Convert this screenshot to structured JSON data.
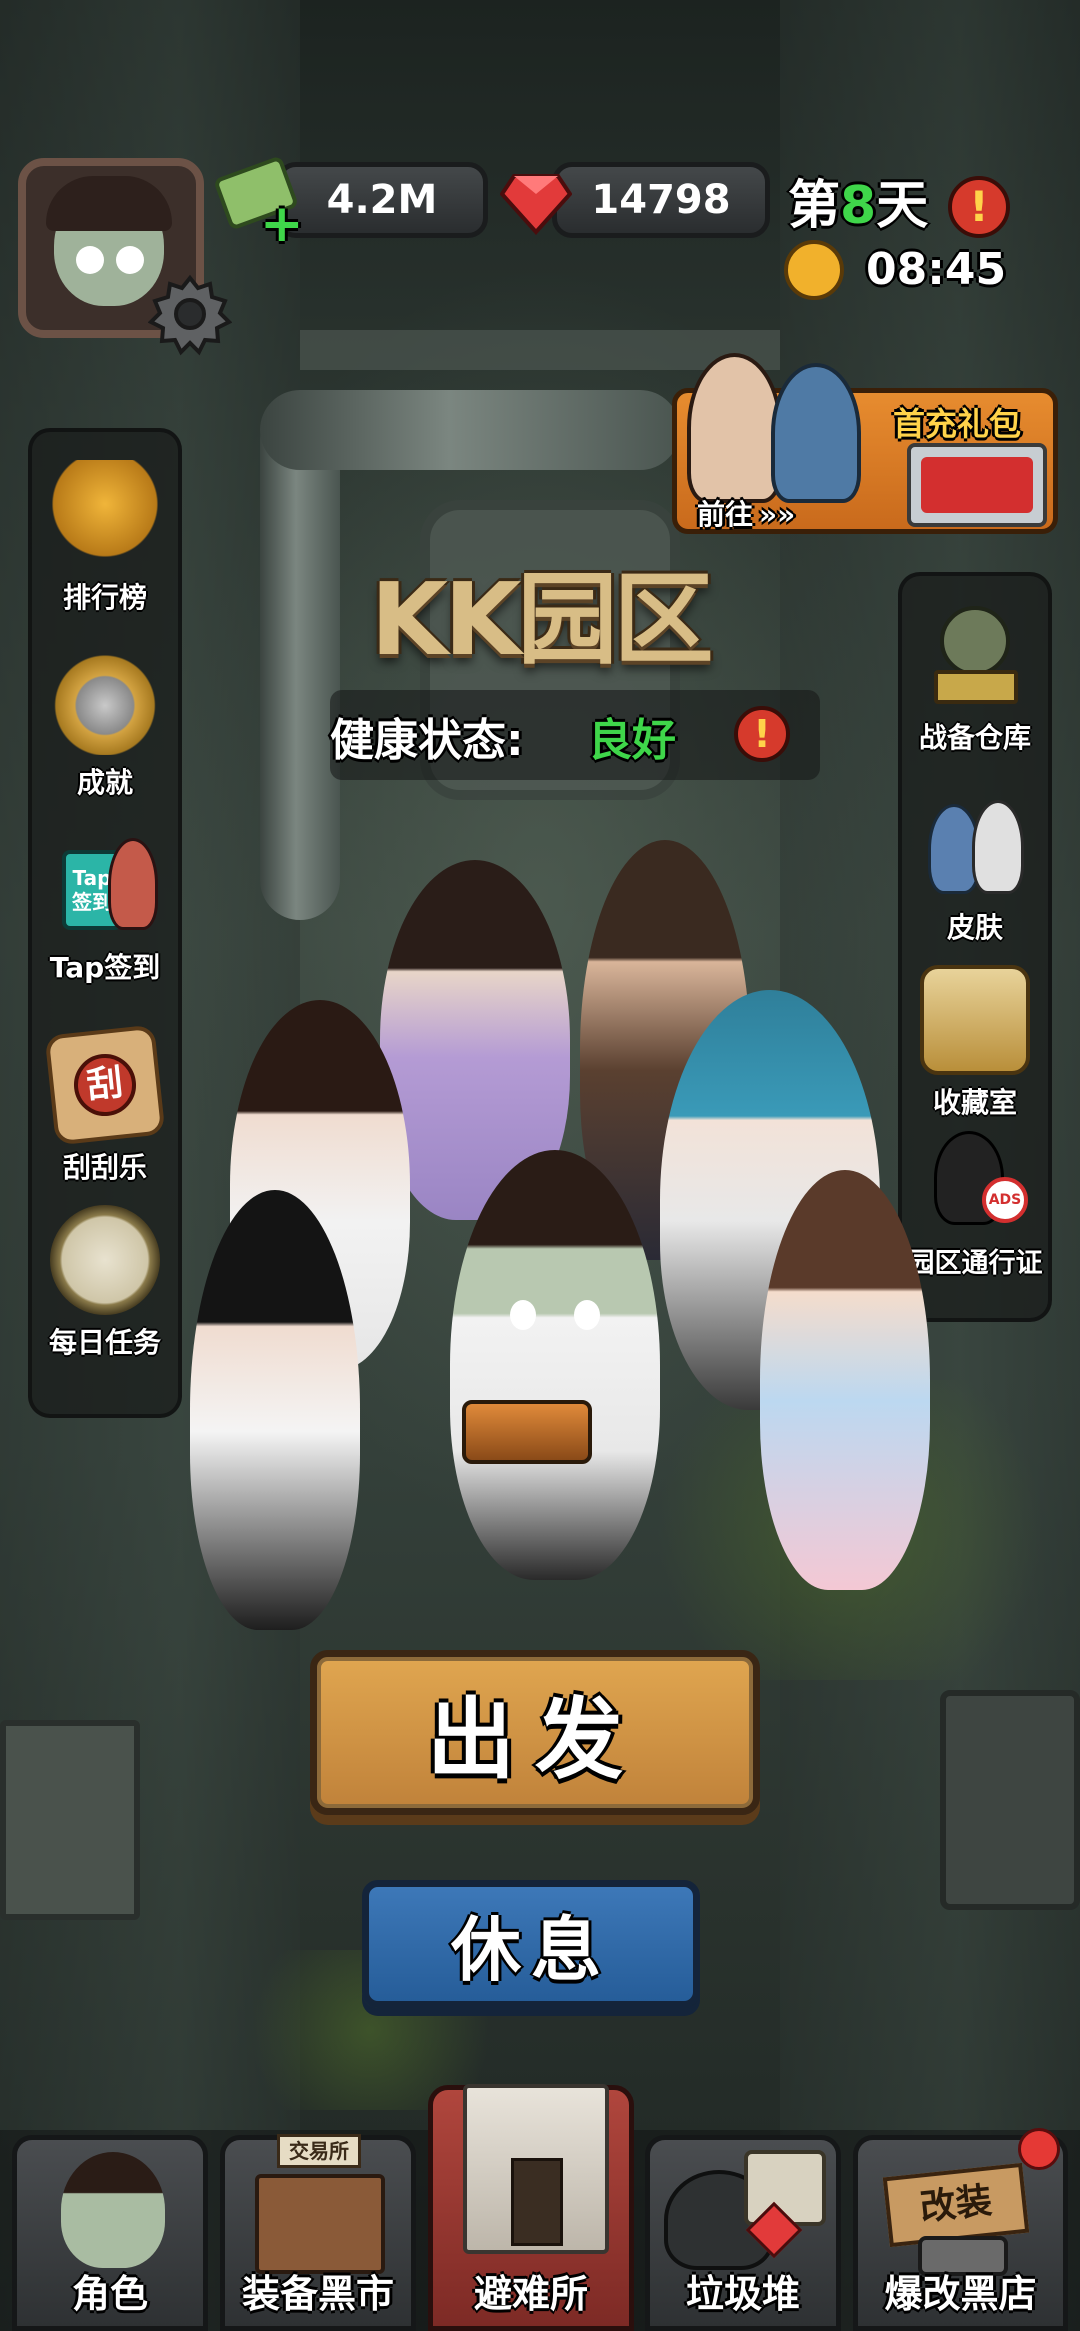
{
  "hud": {
    "cash": "4.2M",
    "gems": "14798",
    "day_prefix": "第",
    "day_number": "8",
    "day_suffix": "天",
    "time": "08:45",
    "alert_icon": "exclamation-icon"
  },
  "promo": {
    "title": "首充礼包",
    "go_label": "前往",
    "arrows": "»»"
  },
  "location": {
    "title": "KK园区",
    "health_label": "健康状态:",
    "health_value": "良好"
  },
  "left_menu": [
    {
      "label": "排行榜",
      "icon": "trophy-icon"
    },
    {
      "label": "成就",
      "icon": "medal-icon"
    },
    {
      "label": "Tap签到",
      "icon": "tap-signin-icon",
      "badge": "Tap",
      "badge_sub": "签到"
    },
    {
      "label": "刮刮乐",
      "icon": "scratch-card-icon",
      "badge": "刮"
    },
    {
      "label": "每日任务",
      "icon": "compass-icon"
    }
  ],
  "right_menu": [
    {
      "label": "战备仓库",
      "icon": "armory-icon"
    },
    {
      "label": "皮肤",
      "icon": "skin-icon"
    },
    {
      "label": "收藏室",
      "icon": "collection-icon"
    },
    {
      "label": "园区通行证",
      "icon": "pass-icon",
      "badge": "ADS"
    }
  ],
  "actions": {
    "go": "出发",
    "rest": "休息"
  },
  "bottom_nav": [
    {
      "label": "角色",
      "icon": "character-icon"
    },
    {
      "label": "装备黑市",
      "icon": "black-market-icon",
      "sign": "交易所"
    },
    {
      "label": "避难所",
      "icon": "shelter-icon"
    },
    {
      "label": "垃圾堆",
      "icon": "junk-pile-icon"
    },
    {
      "label": "爆改黑店",
      "icon": "mod-shop-icon",
      "sign": "改装"
    }
  ],
  "colors": {
    "health_good": "#3fd64a",
    "day_number": "#3fd64a",
    "promo_title": "#ffd34a",
    "active_tab": "#b0463d",
    "go_button": "#e0a650",
    "rest_button": "#3d78b8"
  }
}
